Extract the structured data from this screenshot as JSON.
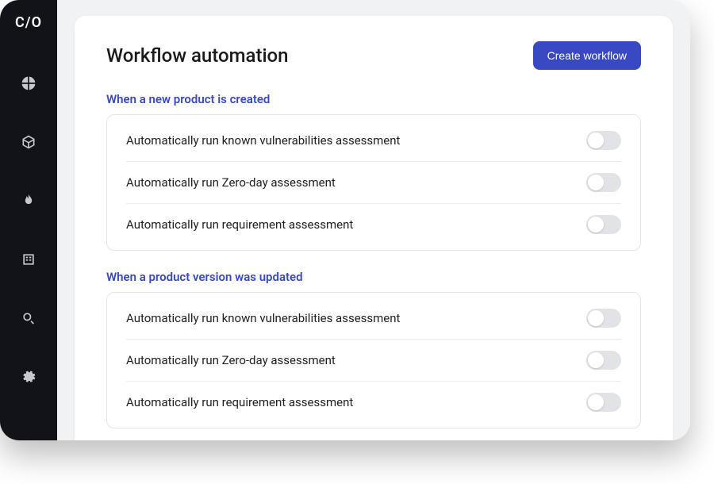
{
  "logo": "C/O",
  "header": {
    "title": "Workflow automation",
    "create_button": "Create workflow"
  },
  "sections": [
    {
      "title": "When a new product is created",
      "rows": [
        {
          "label": "Automatically run known vulnerabilities assessment",
          "enabled": false
        },
        {
          "label": "Automatically run Zero-day assessment",
          "enabled": false
        },
        {
          "label": "Automatically run requirement assessment",
          "enabled": false
        }
      ]
    },
    {
      "title": "When a product version was updated",
      "rows": [
        {
          "label": "Automatically run known vulnerabilities assessment",
          "enabled": false
        },
        {
          "label": "Automatically run Zero-day assessment",
          "enabled": false
        },
        {
          "label": "Automatically run requirement assessment",
          "enabled": false
        }
      ]
    }
  ],
  "sidebar": {
    "items": [
      {
        "name": "dashboard"
      },
      {
        "name": "products"
      },
      {
        "name": "vulnerabilities"
      },
      {
        "name": "reports"
      },
      {
        "name": "search"
      },
      {
        "name": "settings"
      }
    ]
  }
}
